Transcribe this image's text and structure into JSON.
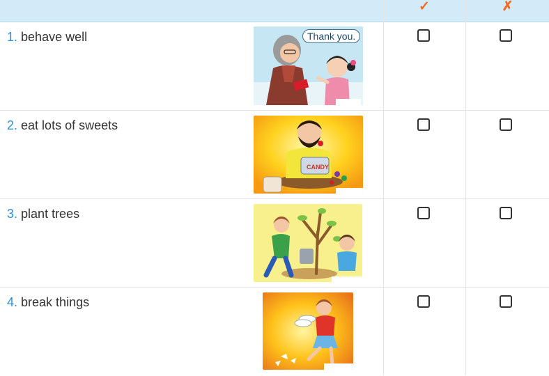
{
  "header": {
    "check_mark": "✓",
    "cross_mark": "✗"
  },
  "colors": {
    "header_bg": "#d3eaf8",
    "mark_color": "#f26b21",
    "number_color": "#2e8fd6",
    "text_color": "#333333"
  },
  "rows": [
    {
      "num": "1.",
      "text": "behave well",
      "picture": "grandma-girl-gift",
      "speech": "Thank you."
    },
    {
      "num": "2.",
      "text": "eat lots of sweets",
      "picture": "boy-eating-candy"
    },
    {
      "num": "3.",
      "text": "plant trees",
      "picture": "kids-planting-tree"
    },
    {
      "num": "4.",
      "text": "break things",
      "picture": "girl-breaking-plates"
    }
  ]
}
